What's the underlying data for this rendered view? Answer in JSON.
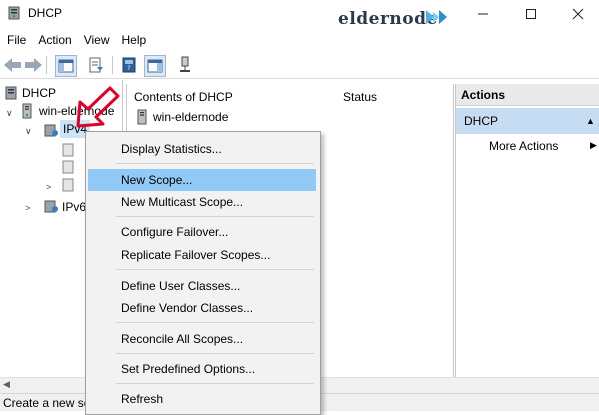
{
  "window": {
    "title": "DHCP",
    "watermark": "eldernode"
  },
  "menubar": [
    "File",
    "Action",
    "View",
    "Help"
  ],
  "toolbar": {
    "icons": [
      "back-arrow-icon",
      "forward-arrow-icon",
      "console-tree-icon",
      "export-list-icon",
      "help-icon",
      "show-hide-icon",
      "server-icon"
    ]
  },
  "tree": {
    "root": "DHCP",
    "server": "win-eldernode",
    "ipv4": "IPv4",
    "ipv6": "IPv6"
  },
  "content": {
    "headers": [
      "Contents of DHCP",
      "Status"
    ],
    "rows": [
      {
        "name": "win-eldernode",
        "status": ""
      }
    ]
  },
  "actions": {
    "header": "Actions",
    "section": "DHCP",
    "more": "More Actions"
  },
  "context_menu": {
    "items": [
      "Display Statistics...",
      "New Scope...",
      "New Multicast Scope...",
      "Configure Failover...",
      "Replicate Failover Scopes...",
      "Define User Classes...",
      "Define Vendor Classes...",
      "Reconcile All Scopes...",
      "Set Predefined Options...",
      "Refresh"
    ],
    "highlighted_index": 1
  },
  "statusbar": {
    "text": "Create a new sco"
  },
  "colors": {
    "highlight": "#91c9f7",
    "actions_selected": "#c6dcf2",
    "arrow": "#e0002a"
  }
}
